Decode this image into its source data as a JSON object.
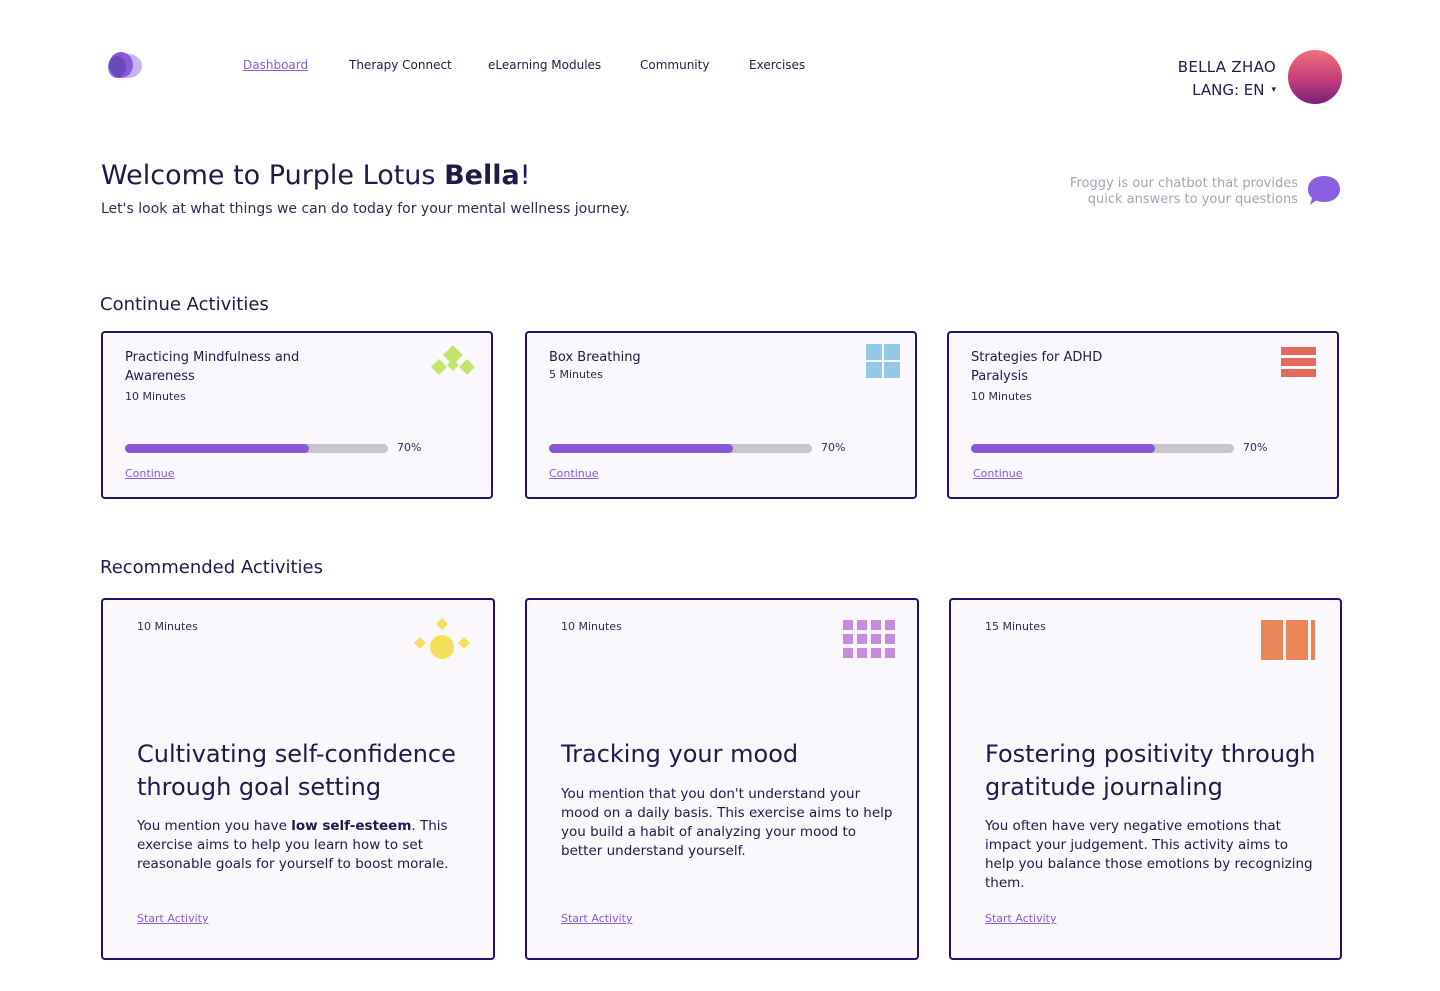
{
  "nav": {
    "items": [
      {
        "label": "Dashboard",
        "active": true
      },
      {
        "label": "Therapy Connect",
        "active": false
      },
      {
        "label": "eLearning Modules",
        "active": false
      },
      {
        "label": "Community",
        "active": false
      },
      {
        "label": "Exercises",
        "active": false
      }
    ]
  },
  "user": {
    "name": "BELLA ZHAO",
    "language": "LANG: EN",
    "caret": "▾"
  },
  "welcome": {
    "prefix": "Welcome to Purple Lotus ",
    "name": "Bella",
    "suffix": "!",
    "subtitle": "Let's look at what things we can do today for your mental wellness journey."
  },
  "froggy": {
    "text": "Froggy is our chatbot that provides quick answers to your questions",
    "icon": "chat-bubble-icon"
  },
  "continue_section": {
    "title": "Continue Activities",
    "cards": [
      {
        "title": "Practicing Mindfulness and Awareness",
        "duration": "10 Minutes",
        "progress": 0.7,
        "progress_label": "70%",
        "link": "Continue",
        "icon": "green-diamonds-icon",
        "icon_color": "#c3e56c"
      },
      {
        "title": "Box Breathing",
        "duration": "5 Minutes",
        "progress": 0.7,
        "progress_label": "70%",
        "link": "Continue",
        "icon": "blue-squares-icon",
        "icon_color": "#93c8e8"
      },
      {
        "title": "Strategies for ADHD Paralysis",
        "duration": "10 Minutes",
        "progress": 0.7,
        "progress_label": "70%",
        "link": "Continue",
        "icon": "red-stripes-icon",
        "icon_color": "#e36b5d"
      }
    ]
  },
  "recommended_section": {
    "title": "Recommended Activities",
    "cards": [
      {
        "duration": "10 Minutes",
        "title": "Cultivating self-confidence through goal setting",
        "desc_before": "You mention you have ",
        "desc_bold": "low self-esteem",
        "desc_after": ". This exercise aims to help you learn how to set reasonable goals for yourself to boost morale.",
        "link": "Start Activity",
        "icon": "yellow-sun-icon",
        "icon_color": "#f5df5a"
      },
      {
        "duration": "10 Minutes",
        "title": "Tracking your mood",
        "desc_before": "You mention that you don't understand your mood on a daily basis. This exercise aims to help you build a habit of analyzing your mood to better understand yourself.",
        "desc_bold": "",
        "desc_after": "",
        "link": "Start Activity",
        "icon": "purple-grid-icon",
        "icon_color": "#c58ce0"
      },
      {
        "duration": "15 Minutes",
        "title": "Fostering positivity through gratitude journaling",
        "desc_before": "You often have very negative emotions that impact your judgement. This activity aims to help you balance those emotions by recognizing them.",
        "desc_bold": "",
        "desc_after": "",
        "link": "Start Activity",
        "icon": "orange-bars-icon",
        "icon_color": "#e88658"
      }
    ]
  },
  "colors": {
    "accent": "#8b5cd6",
    "border": "#2a0f70",
    "text": "#1f1a4a",
    "card_bg": "#faf7fd",
    "track": "#c8c4cc",
    "fill": "#8757d8"
  }
}
